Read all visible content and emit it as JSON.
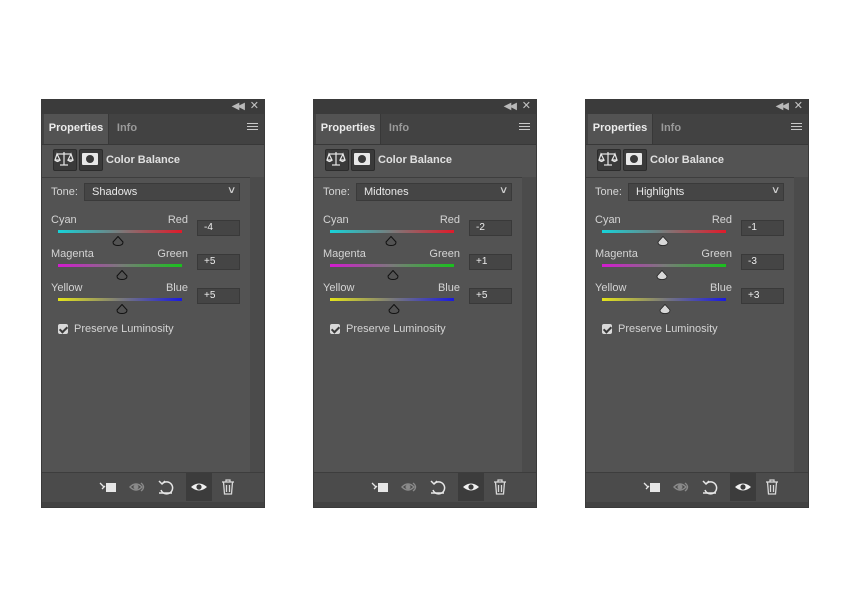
{
  "panels": [
    {
      "tabs": {
        "properties": "Properties",
        "info": "Info"
      },
      "title": "Color Balance",
      "tone_label": "Tone:",
      "tone_value": "Shadows",
      "sliders": [
        {
          "left": "Cyan",
          "right": "Red",
          "value": "-4",
          "level": 0.48
        },
        {
          "left": "Magenta",
          "right": "Green",
          "value": "+5",
          "level": 0.52
        },
        {
          "left": "Yellow",
          "right": "Blue",
          "value": "+5",
          "level": 0.52
        }
      ],
      "preserve_label": "Preserve Luminosity",
      "preserve_checked": true
    },
    {
      "tabs": {
        "properties": "Properties",
        "info": "Info"
      },
      "title": "Color Balance",
      "tone_label": "Tone:",
      "tone_value": "Midtones",
      "sliders": [
        {
          "left": "Cyan",
          "right": "Red",
          "value": "-2",
          "level": 0.49
        },
        {
          "left": "Magenta",
          "right": "Green",
          "value": "+1",
          "level": 0.505
        },
        {
          "left": "Yellow",
          "right": "Blue",
          "value": "+5",
          "level": 0.52
        }
      ],
      "preserve_label": "Preserve Luminosity",
      "preserve_checked": true
    },
    {
      "tabs": {
        "properties": "Properties",
        "info": "Info"
      },
      "title": "Color Balance",
      "tone_label": "Tone:",
      "tone_value": "Highlights",
      "sliders": [
        {
          "left": "Cyan",
          "right": "Red",
          "value": "-1",
          "level": 0.495
        },
        {
          "left": "Magenta",
          "right": "Green",
          "value": "-3",
          "level": 0.485
        },
        {
          "left": "Yellow",
          "right": "Blue",
          "value": "+3",
          "level": 0.51
        }
      ],
      "preserve_label": "Preserve Luminosity",
      "preserve_checked": true
    }
  ],
  "slider_gradients": [
    [
      "#16d3d9",
      "#e01a2a"
    ],
    [
      "#d41ad0",
      "#18c21c"
    ],
    [
      "#e4e41a",
      "#1a1ae0"
    ]
  ],
  "icons": {
    "collapse": "double-chevron-left-icon",
    "close": "close-icon",
    "menu": "hamburger-menu-icon",
    "adjustment": "balance-scale-icon",
    "mask": "layer-mask-icon",
    "footer": [
      "clip-to-layer-icon",
      "view-previous-state-icon",
      "reset-icon",
      "visibility-eye-icon",
      "trash-icon"
    ]
  }
}
